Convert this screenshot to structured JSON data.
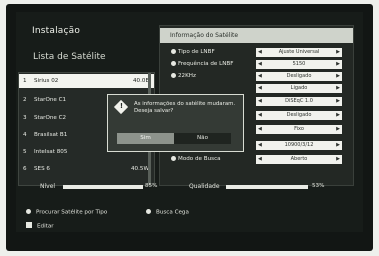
{
  "title": "Instalação",
  "list_header": "Lista de Satélite",
  "satellites": [
    {
      "num": "1",
      "name": "Sirius 02",
      "pos": "40.0E",
      "selected": true
    },
    {
      "num": "2",
      "name": "StarOne C1",
      "pos": "",
      "selected": false
    },
    {
      "num": "3",
      "name": "StarOne C2",
      "pos": "",
      "selected": false
    },
    {
      "num": "4",
      "name": "Brasilsat B1",
      "pos": "",
      "selected": false
    },
    {
      "num": "5",
      "name": "Intelsat 805",
      "pos": "",
      "selected": false
    },
    {
      "num": "6",
      "name": "SES 6",
      "pos": "40.5W",
      "selected": false
    }
  ],
  "info_header": "Informação do Satélite",
  "info_rows": [
    {
      "label": "Tipo de LNBF",
      "value": "Ajuste Universal"
    },
    {
      "label": "Frequência de LNBF",
      "value": "5150"
    },
    {
      "label": "22KHz",
      "value": "Desligado"
    },
    {
      "label": "",
      "value": "Ligado"
    },
    {
      "label": "",
      "value": "DiSEqC 1.0"
    },
    {
      "label": "",
      "value": "Desligado"
    },
    {
      "label": "",
      "value": "Fixo"
    },
    {
      "label": "",
      "value": "10900/3/12"
    },
    {
      "label": "Modo de Busca",
      "value": "Aberto"
    }
  ],
  "dialog": {
    "icon": "!",
    "message": "As informações do satélite mudaram. Deseja salvar?",
    "yes_label": "Sim",
    "no_label": "Não"
  },
  "signal": {
    "label": "Nível",
    "value": "85%"
  },
  "quality": {
    "label": "Qualidade",
    "value": "53%"
  },
  "legend": {
    "search": "Procurar Satélite por Tipo",
    "blind": "Busca Cega",
    "edit": "Editar"
  },
  "colors": {
    "panel_bg": "#171c19",
    "highlight": "#f3f4ef",
    "field_bg": "#f1f2ed"
  }
}
